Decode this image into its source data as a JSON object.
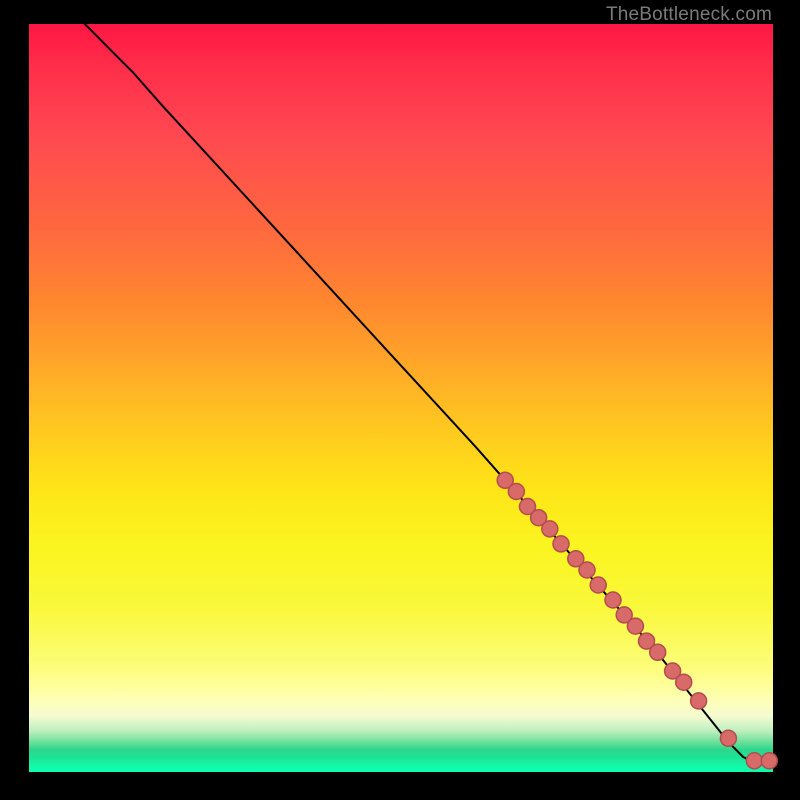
{
  "attribution": "TheBottleneck.com",
  "colors": {
    "dot_fill": "#d86a6a",
    "dot_stroke": "#b34c4c",
    "curve": "#000000"
  },
  "chart_data": {
    "type": "line",
    "title": "",
    "xlabel": "",
    "ylabel": "",
    "xlim": [
      0,
      100
    ],
    "ylim": [
      0,
      100
    ],
    "grid": false,
    "legend": false,
    "series": [
      {
        "name": "curve",
        "kind": "line",
        "x": [
          7.5,
          9,
          11,
          14,
          18,
          24,
          30,
          36,
          42,
          48,
          54,
          60,
          64,
          68,
          72,
          76,
          80,
          84,
          86,
          88,
          90,
          92,
          94,
          96,
          98,
          100
        ],
        "y": [
          100,
          98.5,
          96.5,
          93.5,
          89,
          82.5,
          76,
          69.5,
          63,
          56.5,
          50,
          43.5,
          39,
          34.5,
          30,
          25.5,
          21,
          16.5,
          14,
          11.5,
          9,
          6.5,
          4,
          2,
          1,
          1
        ]
      },
      {
        "name": "points",
        "kind": "scatter",
        "x": [
          64,
          65.5,
          67,
          68.5,
          70,
          71.5,
          73.5,
          75,
          76.5,
          78.5,
          80,
          81.5,
          83,
          84.5,
          86.5,
          88,
          90,
          94,
          97.5,
          99.5
        ],
        "y": [
          39,
          37.5,
          35.5,
          34,
          32.5,
          30.5,
          28.5,
          27,
          25,
          23,
          21,
          19.5,
          17.5,
          16,
          13.5,
          12,
          9.5,
          4.5,
          1.5,
          1.5
        ]
      }
    ]
  }
}
